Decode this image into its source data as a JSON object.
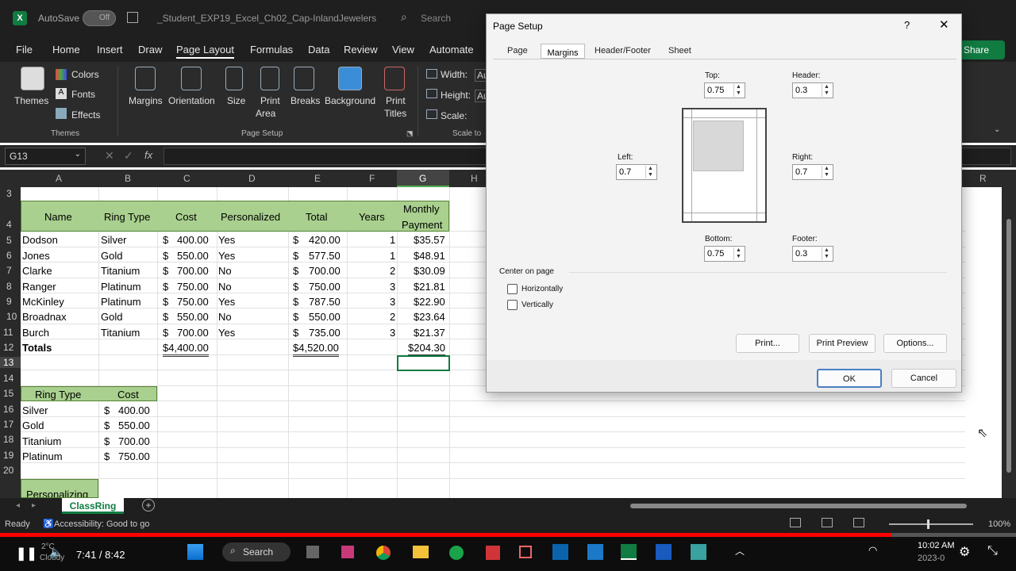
{
  "titlebar": {
    "autosave": "AutoSave",
    "autosave_state": "Off",
    "filename": "_Student_EXP19_Excel_Ch02_Cap-InlandJewelers",
    "search": "Search"
  },
  "menu": [
    "File",
    "Home",
    "Insert",
    "Draw",
    "Page Layout",
    "Formulas",
    "Data",
    "Review",
    "View",
    "Automate"
  ],
  "share": "Share",
  "ribbon": {
    "themes": "Themes",
    "colors": "Colors",
    "fonts": "Fonts",
    "effects": "Effects",
    "margins": "Margins",
    "orientation": "Orientation",
    "size": "Size",
    "print_area_1": "Print",
    "print_area_2": "Area",
    "breaks": "Breaks",
    "background": "Background",
    "print_titles_1": "Print",
    "print_titles_2": "Titles",
    "width": "Width:",
    "height": "Height:",
    "scale": "Scale:",
    "auto": "Au",
    "grp_themes": "Themes",
    "grp_page_setup": "Page Setup",
    "grp_scale": "Scale to"
  },
  "formula_bar": {
    "name_box": "G13",
    "fx": "fx",
    "value": ""
  },
  "columns": [
    "A",
    "B",
    "C",
    "D",
    "E",
    "F",
    "G",
    "H",
    "R"
  ],
  "rows": [
    "3",
    "4",
    "5",
    "6",
    "7",
    "8",
    "9",
    "10",
    "11",
    "12",
    "13",
    "14",
    "15",
    "16",
    "17",
    "18",
    "19",
    "20"
  ],
  "table1": {
    "headers": [
      "Name",
      "Ring Type",
      "Cost",
      "Personalized",
      "Total",
      "Years",
      "Monthly",
      "Payment"
    ],
    "data": [
      [
        "Dodson",
        "Silver",
        "$",
        "400.00",
        "Yes",
        "$",
        "420.00",
        "1",
        "$35.57"
      ],
      [
        "Jones",
        "Gold",
        "$",
        "550.00",
        "Yes",
        "$",
        "577.50",
        "1",
        "$48.91"
      ],
      [
        "Clarke",
        "Titanium",
        "$",
        "700.00",
        "No",
        "$",
        "700.00",
        "2",
        "$30.09"
      ],
      [
        "Ranger",
        "Platinum",
        "$",
        "750.00",
        "No",
        "$",
        "750.00",
        "3",
        "$21.81"
      ],
      [
        "McKinley",
        "Platinum",
        "$",
        "750.00",
        "Yes",
        "$",
        "787.50",
        "3",
        "$22.90"
      ],
      [
        "Broadnax",
        "Gold",
        "$",
        "550.00",
        "No",
        "$",
        "550.00",
        "2",
        "$23.64"
      ],
      [
        "Burch",
        "Titanium",
        "$",
        "700.00",
        "Yes",
        "$",
        "735.00",
        "3",
        "$21.37"
      ]
    ],
    "totals": [
      "Totals",
      "$4,400.00",
      "$4,520.00",
      "$204.30"
    ]
  },
  "table2": {
    "headers": [
      "Ring Type",
      "Cost"
    ],
    "data": [
      [
        "Silver",
        "$",
        "400.00"
      ],
      [
        "Gold",
        "$",
        "550.00"
      ],
      [
        "Titanium",
        "$",
        "700.00"
      ],
      [
        "Platinum",
        "$",
        "750.00"
      ]
    ]
  },
  "personalize": "Personalizing",
  "sheet_tab": "ClassRing",
  "status": {
    "ready": "Ready",
    "accessibility": "Accessibility: Good to go",
    "zoom": "100%"
  },
  "dialog": {
    "title": "Page Setup",
    "help": "?",
    "close": "✕",
    "tabs": [
      "Page",
      "Margins",
      "Header/Footer",
      "Sheet"
    ],
    "top_label": "Top:",
    "top_value": "0.75",
    "header_label": "Header:",
    "header_value": "0.3",
    "left_label": "Left:",
    "left_value": "0.7",
    "right_label": "Right:",
    "right_value": "0.7",
    "bottom_label": "Bottom:",
    "bottom_value": "0.75",
    "footer_label": "Footer:",
    "footer_value": "0.3",
    "center_label": "Center on page",
    "horizontally": "Horizontally",
    "vertically": "Vertically",
    "print": "Print...",
    "print_preview": "Print Preview",
    "options": "Options...",
    "ok": "OK",
    "cancel": "Cancel"
  },
  "video": {
    "time": "7:41 / 8:42",
    "progress": 0.877,
    "temp": "2°C",
    "weather": "Cloudy",
    "taskbar_search": "Search",
    "clock_time": "10:02 AM",
    "clock_date": "2023-0"
  },
  "colors": {
    "accent_green": "#a9d08e",
    "excel_green": "#107c41",
    "progress_red": "#ff0000"
  }
}
